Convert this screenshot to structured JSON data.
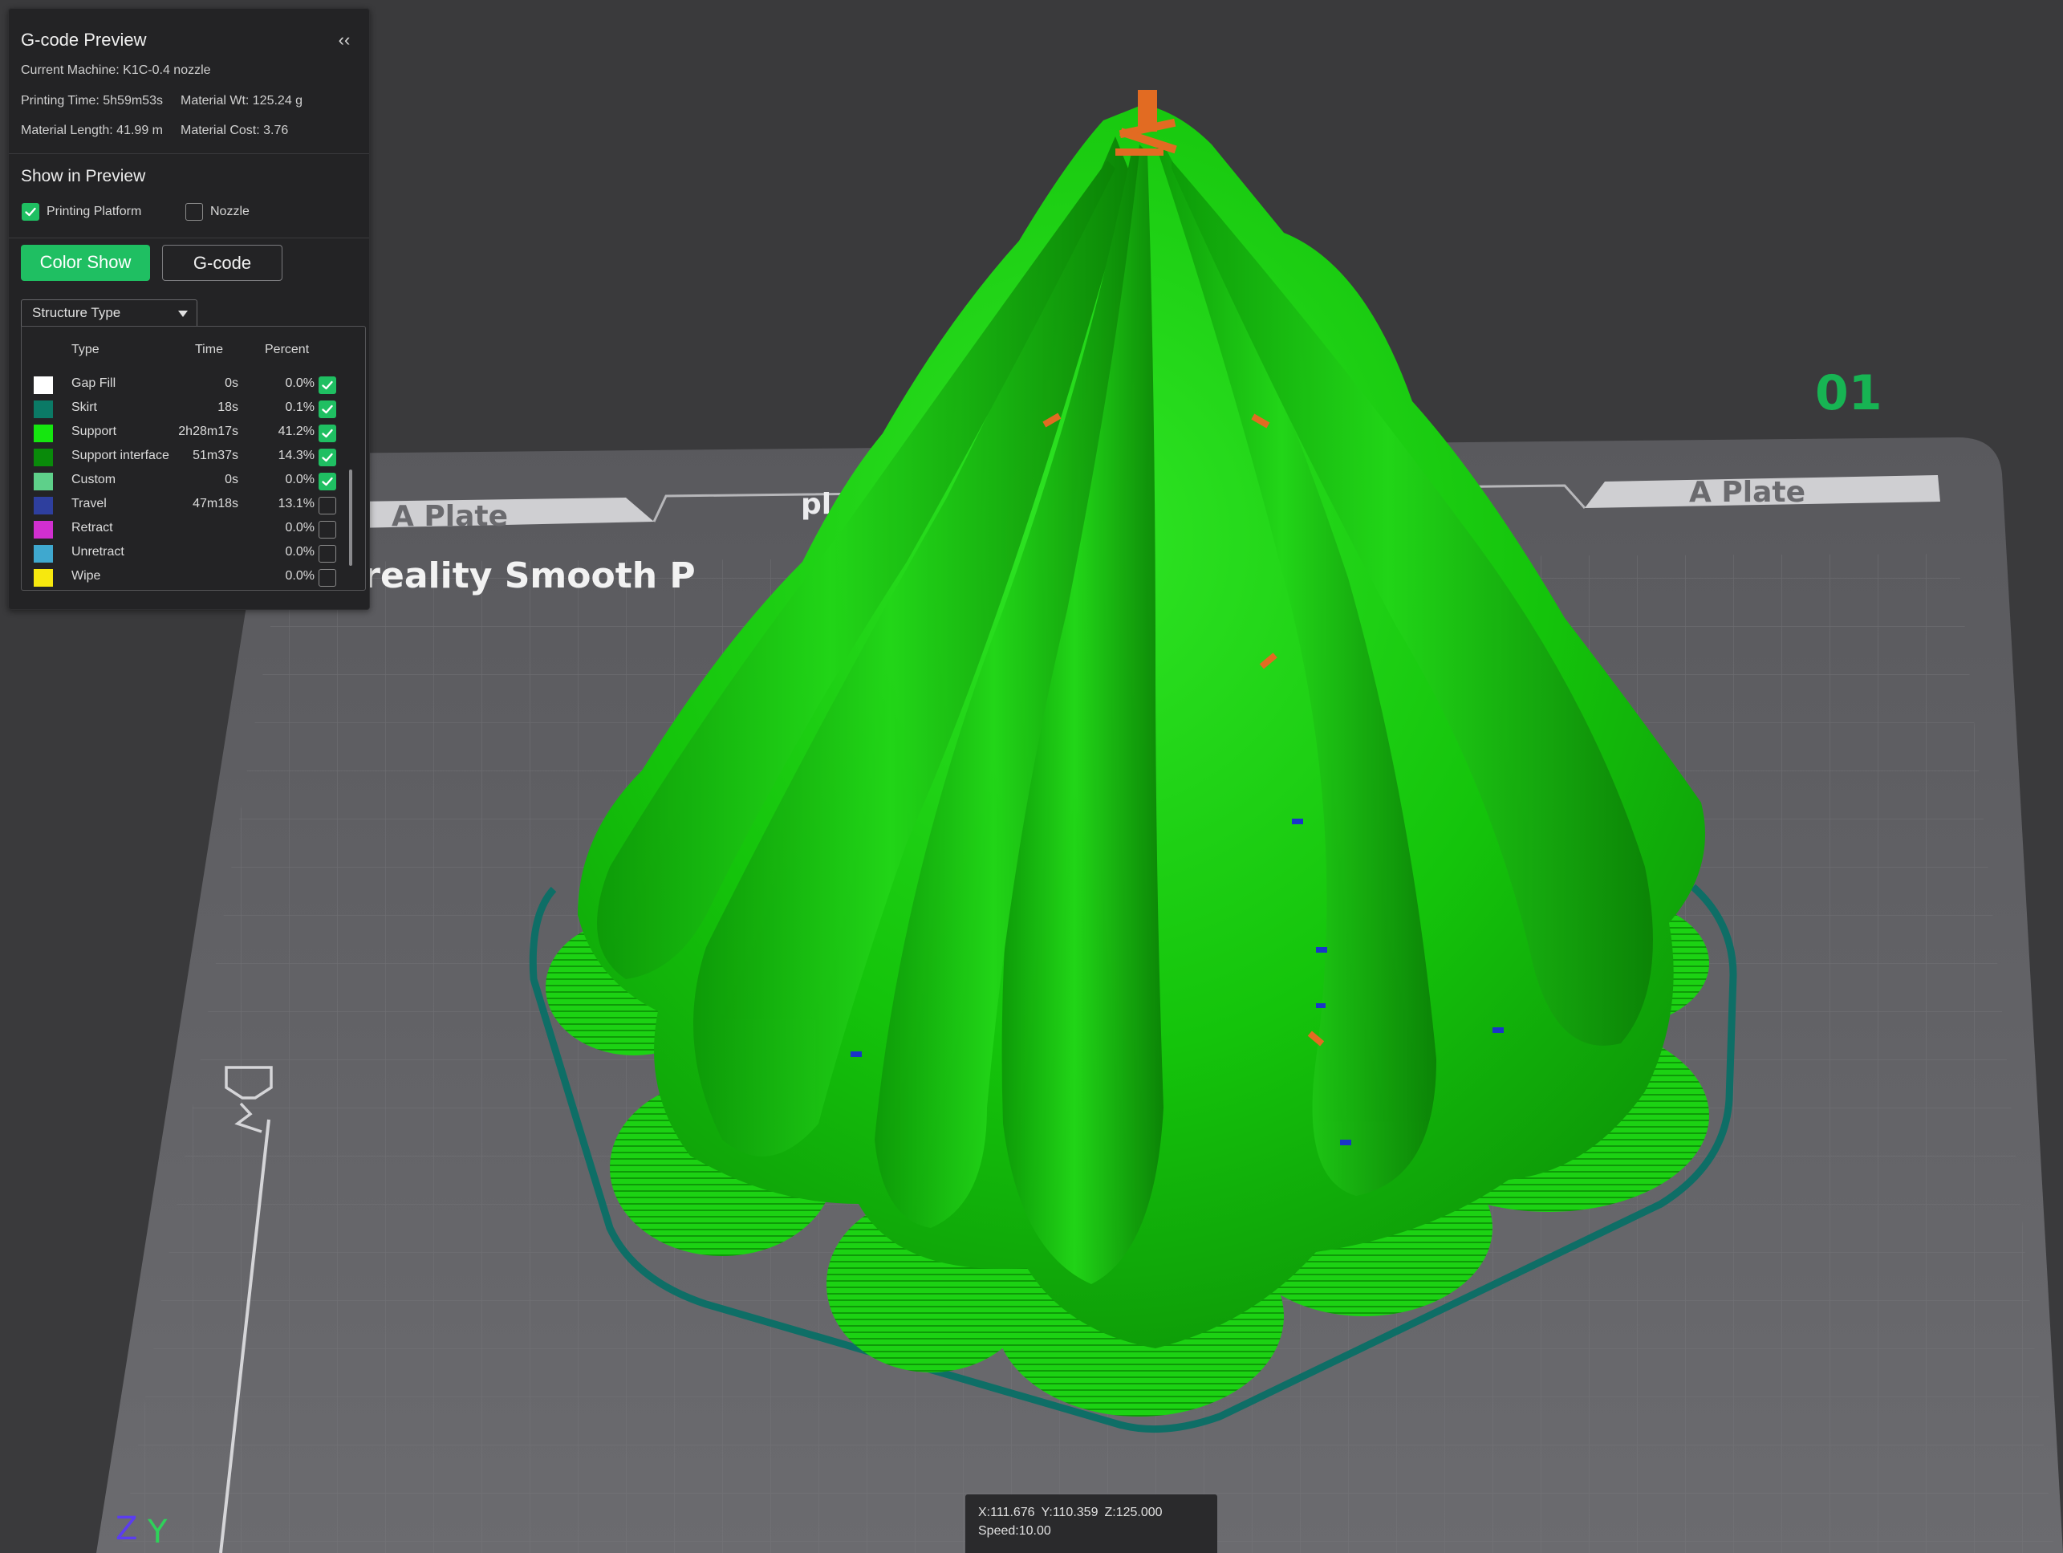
{
  "preview": {
    "title": "G-code Preview",
    "collapse_glyph": "‹‹",
    "machine": "Current Machine: K1C-0.4 nozzle",
    "printing_time": "Printing Time: 5h59m53s",
    "material_weight": "Material Wt: 125.24 g",
    "material_length": "Material Length: 41.99 m",
    "material_cost": "Material Cost: 3.76"
  },
  "show_in_preview": {
    "title": "Show in Preview",
    "printing_platform": {
      "label": "Printing Platform",
      "checked": true
    },
    "nozzle": {
      "label": "Nozzle",
      "checked": false
    }
  },
  "modes": {
    "color_show": "Color Show",
    "gcode": "G-code"
  },
  "structure_select": {
    "value": "Structure Type"
  },
  "legend": {
    "headers": {
      "type": "Type",
      "time": "Time",
      "percent": "Percent"
    },
    "rows": [
      {
        "type": "Gap Fill",
        "time": "0s",
        "percent": "0.0%",
        "color": "#ffffff",
        "checked": true
      },
      {
        "type": "Skirt",
        "time": "18s",
        "percent": "0.1%",
        "color": "#0b7a66",
        "checked": true
      },
      {
        "type": "Support",
        "time": "2h28m17s",
        "percent": "41.2%",
        "color": "#15e60f",
        "checked": true
      },
      {
        "type": "Support interface",
        "time": "51m37s",
        "percent": "14.3%",
        "color": "#098a0a",
        "checked": true
      },
      {
        "type": "Custom",
        "time": "0s",
        "percent": "0.0%",
        "color": "#5ed08a",
        "checked": true
      },
      {
        "type": "Travel",
        "time": "47m18s",
        "percent": "13.1%",
        "color": "#2e3f9e",
        "checked": false
      },
      {
        "type": "Retract",
        "time": "",
        "percent": "0.0%",
        "color": "#d12fd0",
        "checked": false
      },
      {
        "type": "Unretract",
        "time": "",
        "percent": "0.0%",
        "color": "#3fa8cf",
        "checked": false
      },
      {
        "type": "Wipe",
        "time": "",
        "percent": "0.0%",
        "color": "#f7e80e",
        "checked": false
      }
    ]
  },
  "scene": {
    "plate_label_left": "A Plate",
    "plate_label_center": "pl",
    "plate_label_right": "A Plate",
    "bed_brand_text": "Creality Smooth P",
    "bed_badge": "01",
    "axis_z": "Z",
    "axis_y": "Y"
  },
  "readout": {
    "x": "X:111.676",
    "y": "Y:110.359",
    "z": "Z:125.000",
    "speed": "Speed:10.00"
  },
  "colors": {
    "accent": "#1fbf62",
    "support": "#15c40c",
    "skirt": "#0b6e63",
    "bed": "#5e5e62",
    "background": "#3a3a3c"
  }
}
